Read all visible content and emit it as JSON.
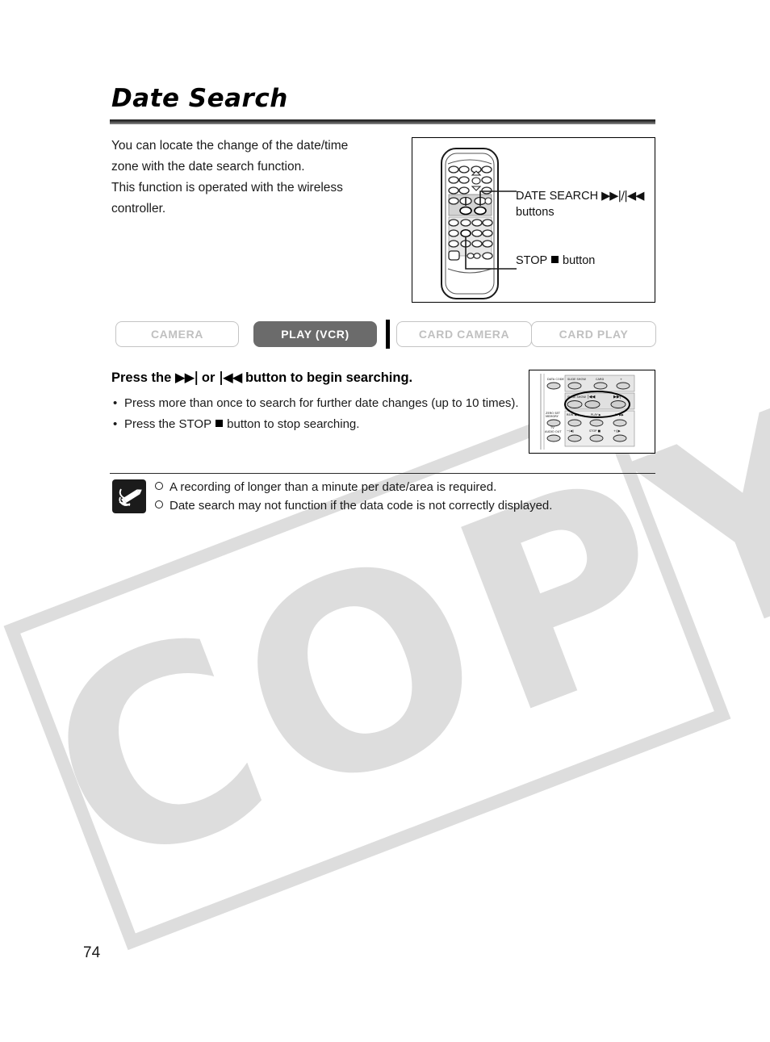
{
  "page": {
    "title": "Date Search",
    "number": "74",
    "watermark": "COPY",
    "watermark_color": "#dddddd"
  },
  "intro": {
    "line1": "You can locate the change of the date/time",
    "line2": "zone with the date search function.",
    "line3": "This function is operated with the wireless",
    "line4": "controller."
  },
  "figure": {
    "callouts": [
      {
        "label_prefix": "DATE SEARCH ",
        "glyph": "▶▶|/|◀◀",
        "label_suffix": "",
        "second_line": "buttons"
      },
      {
        "label_prefix": "STOP ",
        "glyph": "■",
        "label_suffix": " button",
        "second_line": ""
      }
    ],
    "remote_name": "wireless-controller"
  },
  "modes": {
    "tabs": [
      {
        "label": "CAMERA",
        "active": false
      },
      {
        "label": "PLAY (VCR)",
        "active": true
      },
      {
        "label": "CARD CAMERA",
        "active": false
      },
      {
        "label": "CARD PLAY",
        "active": false
      }
    ]
  },
  "step": {
    "heading_part1": "Press the ",
    "heading_glyph1": "▶▶|",
    "heading_part2": " or ",
    "heading_glyph2": "|◀◀",
    "heading_part3": " button to begin searching.",
    "bullets": [
      "Press more than once to search for further date changes (up to 10 times).",
      "Press the STOP ■ button to stop searching."
    ],
    "bullet_2_prefix": "Press the STOP ",
    "bullet_2_suffix": " button to stop searching."
  },
  "inset": {
    "button_labels": {
      "data_code": "DATA CODE",
      "slide_show": "SLIDE SHOW",
      "card": "CARD",
      "card_plus": "+",
      "slide_show_2": "SLIDE SHOW",
      "rew_back": "|◀◀",
      "ff_fwd": "▶▶|",
      "zero_set": "ZERO SET",
      "memory": "MEMORY",
      "rew": "REW",
      "play": "PLAY",
      "ff": "FF",
      "tv_screen": "TV",
      "audio_out": "AUDIO OUT",
      "slow_rev": "−/◀‖",
      "stop": "STOP",
      "slow_fwd": "+/‖▶"
    }
  },
  "notes": {
    "items": [
      "A recording of longer than a minute per date/area is required.",
      "Date search may not function if the data code is not correctly displayed."
    ],
    "icon": "memo-pencil-icon"
  }
}
